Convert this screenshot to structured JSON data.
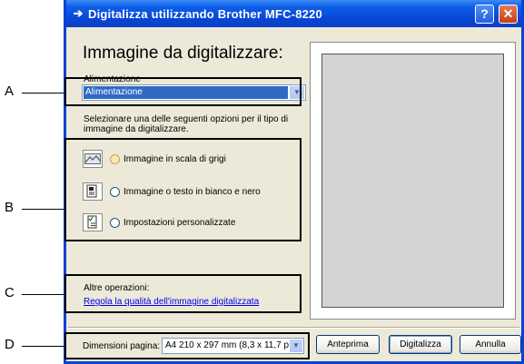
{
  "callouts": {
    "a": "A",
    "b": "B",
    "c": "C",
    "d": "D"
  },
  "window": {
    "title": "Digitalizza utilizzando Brother MFC-8220",
    "help_glyph": "?",
    "close_glyph": "✕"
  },
  "main": {
    "heading": "Immagine da digitalizzare:",
    "source_label": "Alimentazione",
    "source_value": "Alimentazione",
    "instructions": "Selezionare una delle seguenti opzioni per il tipo di immagine da digitalizzare.",
    "options": [
      {
        "label": "Immagine in scala di grigi",
        "icon": "grayscale-picture-icon",
        "selected": true
      },
      {
        "label": "Immagine o testo in bianco e nero",
        "icon": "bw-document-icon",
        "selected": false
      },
      {
        "label": "Impostazioni personalizzate",
        "icon": "custom-settings-icon",
        "selected": false
      }
    ],
    "other_ops_label": "Altre operazioni:",
    "other_ops_link": "Regola la qualità dell'immagine digitalizzata"
  },
  "footer": {
    "page_size_label": "Dimensioni pagina:",
    "page_size_value": "A4 210 x 297 mm (8,3 x 11,7 p",
    "preview_button": "Anteprima",
    "scan_button": "Digitalizza",
    "cancel_button": "Annulla"
  },
  "colors": {
    "titlebar": "#0846d6",
    "dialog_bg": "#ece9d8",
    "selection": "#316ac5",
    "link": "#0000ee"
  }
}
